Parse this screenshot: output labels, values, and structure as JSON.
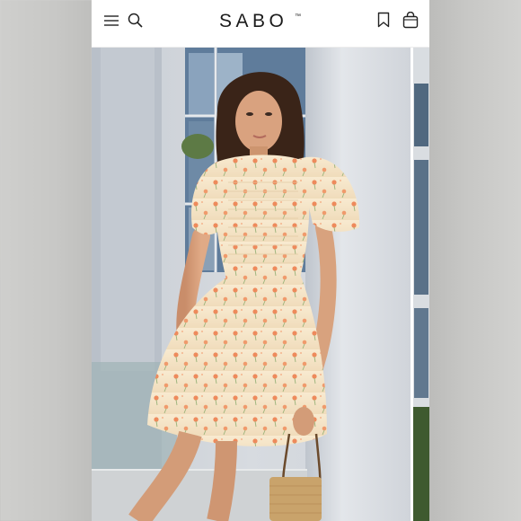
{
  "header": {
    "brand": "SABO",
    "brand_mark": "™",
    "icons": [
      "menu-icon",
      "search-icon",
      "bookmark-icon",
      "shopping-bag-icon"
    ]
  },
  "gallery": {
    "current_image": "product-photo-floral-smocked-mini-dress",
    "next_image_peek": true
  },
  "colors": {
    "header_bg": "#ffffff",
    "brand_text": "#1b1b1b",
    "dress_base": "#f6e6c9",
    "flower_print": "#ec8a5e"
  }
}
